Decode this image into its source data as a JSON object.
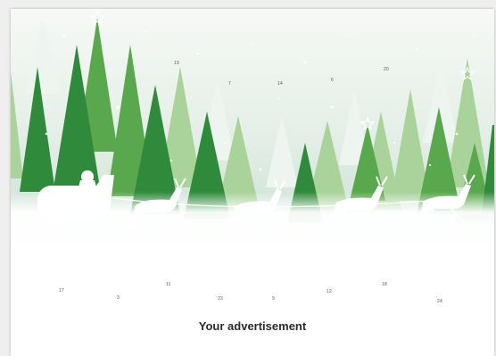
{
  "calendar": {
    "ad_text": "Your advertisement",
    "scene_numbers": [
      "19",
      "7",
      "14",
      "6",
      "20",
      "2",
      "16"
    ],
    "door_numbers": [
      "17",
      "3",
      "11",
      "23",
      "9",
      "12",
      "18",
      "24"
    ]
  },
  "colors": {
    "page_bg": "#efefef",
    "card_bg": "#ffffff",
    "sky_top": "#f7f9f6",
    "sky_bottom": "#c7dfd0",
    "tree_dark": "#2f8a3b",
    "tree_mid": "#5aa84e",
    "tree_light": "#a9d39b",
    "silhouette": "#ffffff"
  }
}
